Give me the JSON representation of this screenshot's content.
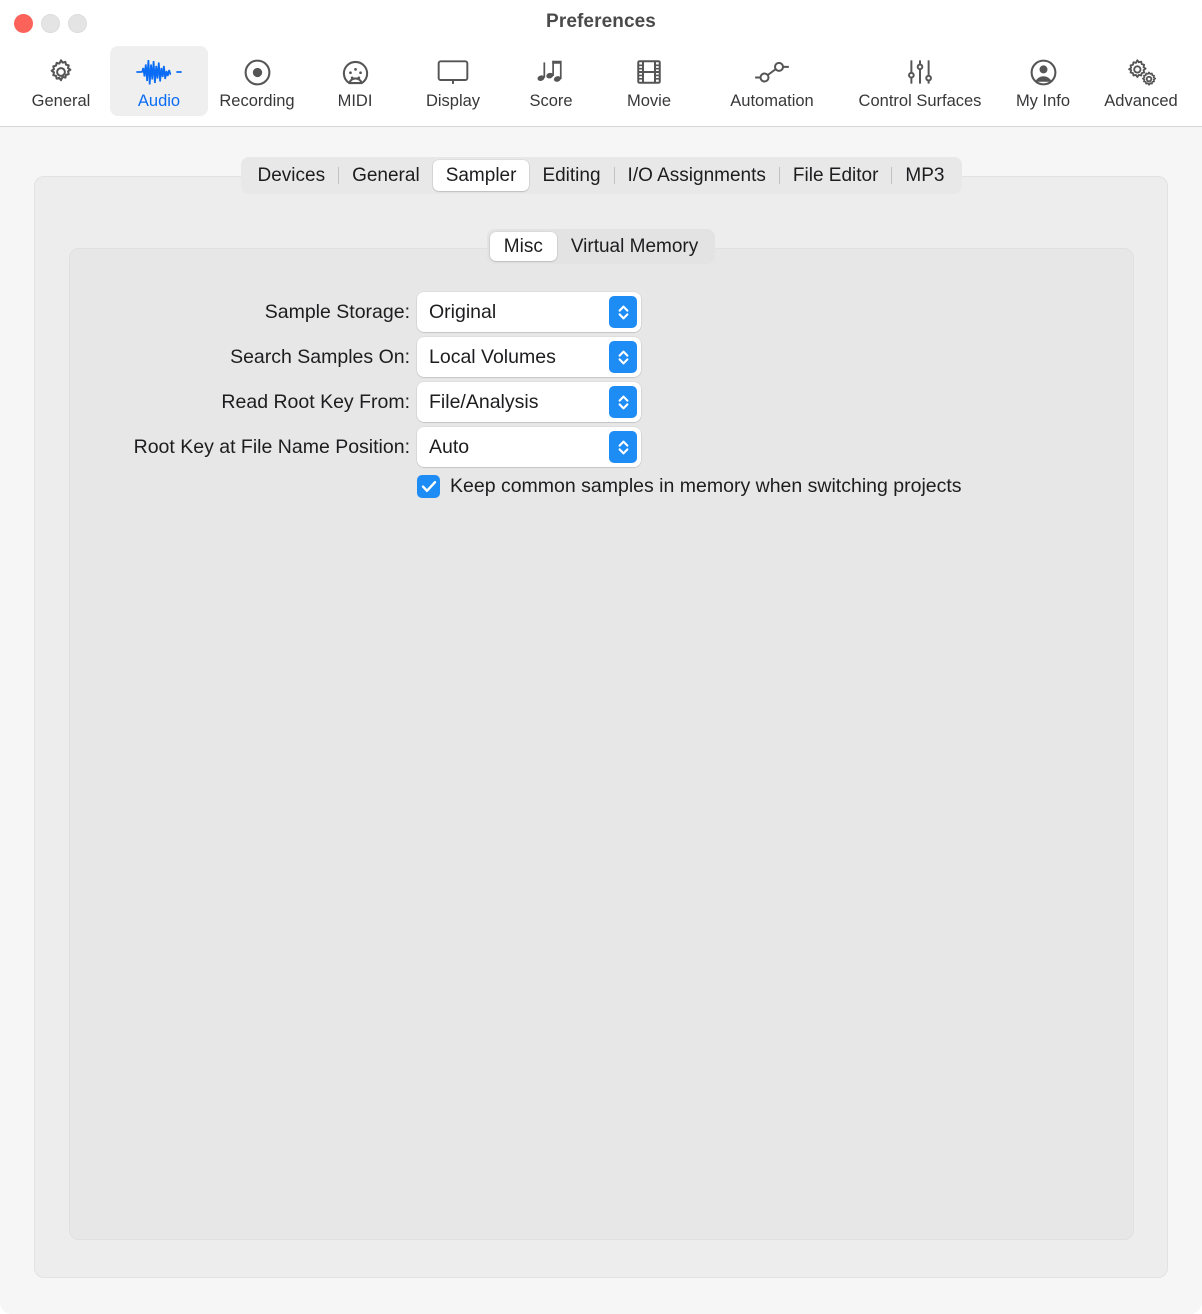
{
  "window": {
    "title": "Preferences",
    "traffic_lights": [
      {
        "name": "close",
        "color": "#fb625a"
      },
      {
        "name": "minimize",
        "color": "#e4e4e4"
      },
      {
        "name": "zoom",
        "color": "#e4e4e4"
      }
    ]
  },
  "toolbar": {
    "selected": "Audio",
    "accent_color": "#0a6cf5",
    "items": [
      {
        "label": "General",
        "icon": "gear-icon"
      },
      {
        "label": "Audio",
        "icon": "waveform-icon"
      },
      {
        "label": "Recording",
        "icon": "record-circle-icon"
      },
      {
        "label": "MIDI",
        "icon": "midi-connector-icon"
      },
      {
        "label": "Display",
        "icon": "display-monitor-icon"
      },
      {
        "label": "Score",
        "icon": "music-notes-icon"
      },
      {
        "label": "Movie",
        "icon": "film-strip-icon"
      },
      {
        "label": "Automation",
        "icon": "automation-nodes-icon"
      },
      {
        "label": "Control Surfaces",
        "icon": "faders-icon"
      },
      {
        "label": "My Info",
        "icon": "person-circle-icon"
      },
      {
        "label": "Advanced",
        "icon": "double-gear-icon"
      }
    ]
  },
  "tabs": {
    "selected": "Sampler",
    "items": [
      {
        "label": "Devices"
      },
      {
        "label": "General"
      },
      {
        "label": "Sampler"
      },
      {
        "label": "Editing"
      },
      {
        "label": "I/O Assignments"
      },
      {
        "label": "File Editor"
      },
      {
        "label": "MP3"
      }
    ]
  },
  "segmented": {
    "selected": "Misc",
    "items": [
      {
        "label": "Misc"
      },
      {
        "label": "Virtual Memory"
      }
    ]
  },
  "form": {
    "rows": [
      {
        "label": "Sample Storage:",
        "value": "Original"
      },
      {
        "label": "Search Samples On:",
        "value": "Local Volumes"
      },
      {
        "label": "Read Root Key From:",
        "value": "File/Analysis"
      },
      {
        "label": "Root Key at File Name Position:",
        "value": "Auto"
      }
    ],
    "checkbox": {
      "label": "Keep common samples in memory when switching projects",
      "checked": true,
      "checked_color": "#1e8cf5"
    }
  }
}
